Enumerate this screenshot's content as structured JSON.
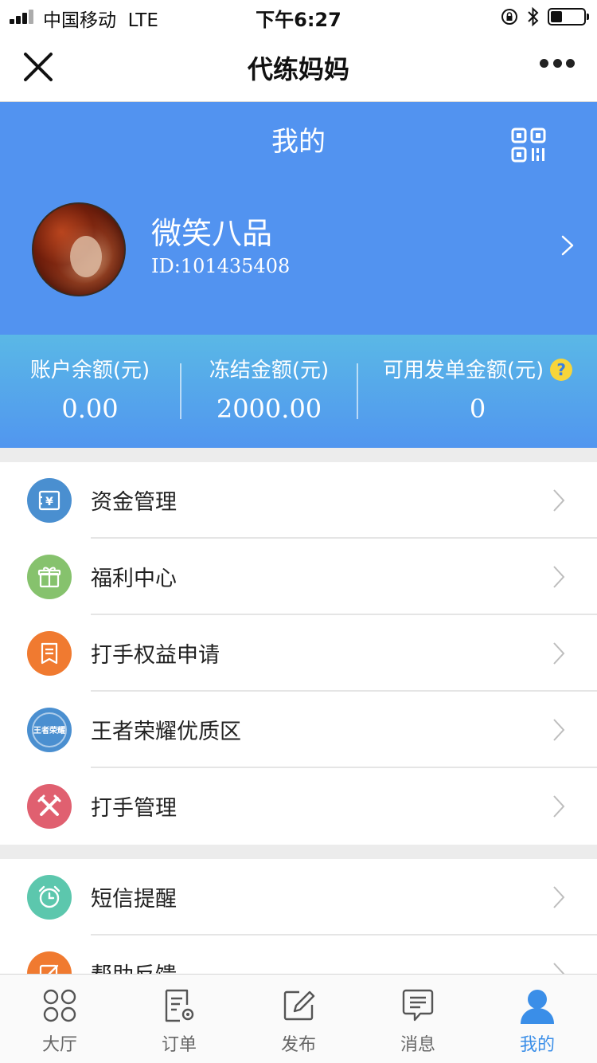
{
  "status_bar": {
    "carrier": "中国移动",
    "network": "LTE",
    "time": "下午6:27",
    "battery_level": 0.35
  },
  "nav": {
    "title": "代练妈妈",
    "close_icon": "close-icon",
    "more_icon": "more-dots-icon"
  },
  "header": {
    "title": "我的",
    "qr_icon": "qr-code-icon",
    "username": "微笑八品",
    "user_id": "ID:101435408",
    "background_color": "#5293f0"
  },
  "balance": {
    "account_label": "账户余额(元)",
    "account_value": "0.00",
    "frozen_label": "冻结金额(元)",
    "frozen_value": "2000.00",
    "available_label": "可用发单金额(元)",
    "available_value": "0",
    "help_symbol": "?"
  },
  "menu_group_1": [
    {
      "label": "资金管理",
      "icon": "wallet-icon",
      "color": "#4a8fd0"
    },
    {
      "label": "福利中心",
      "icon": "gift-icon",
      "color": "#86c26d"
    },
    {
      "label": "打手权益申请",
      "icon": "document-icon",
      "color": "#f07a30"
    },
    {
      "label": "王者荣耀优质区",
      "icon": "game-logo-icon",
      "color": "#4a8fd0"
    },
    {
      "label": "打手管理",
      "icon": "crossed-swords-icon",
      "color": "#e06070"
    }
  ],
  "menu_group_2": [
    {
      "label": "短信提醒",
      "icon": "alarm-clock-icon",
      "color": "#5cc7ad"
    },
    {
      "label": "帮助反馈",
      "icon": "feedback-edit-icon",
      "color": "#f07a30"
    }
  ],
  "tabs": [
    {
      "label": "大厅",
      "icon": "four-circles-icon",
      "active": false
    },
    {
      "label": "订单",
      "icon": "order-list-icon",
      "active": false
    },
    {
      "label": "发布",
      "icon": "publish-edit-icon",
      "active": false
    },
    {
      "label": "消息",
      "icon": "message-bubble-icon",
      "active": false
    },
    {
      "label": "我的",
      "icon": "person-icon",
      "active": true
    }
  ],
  "game_logo_text": "王者荣耀"
}
